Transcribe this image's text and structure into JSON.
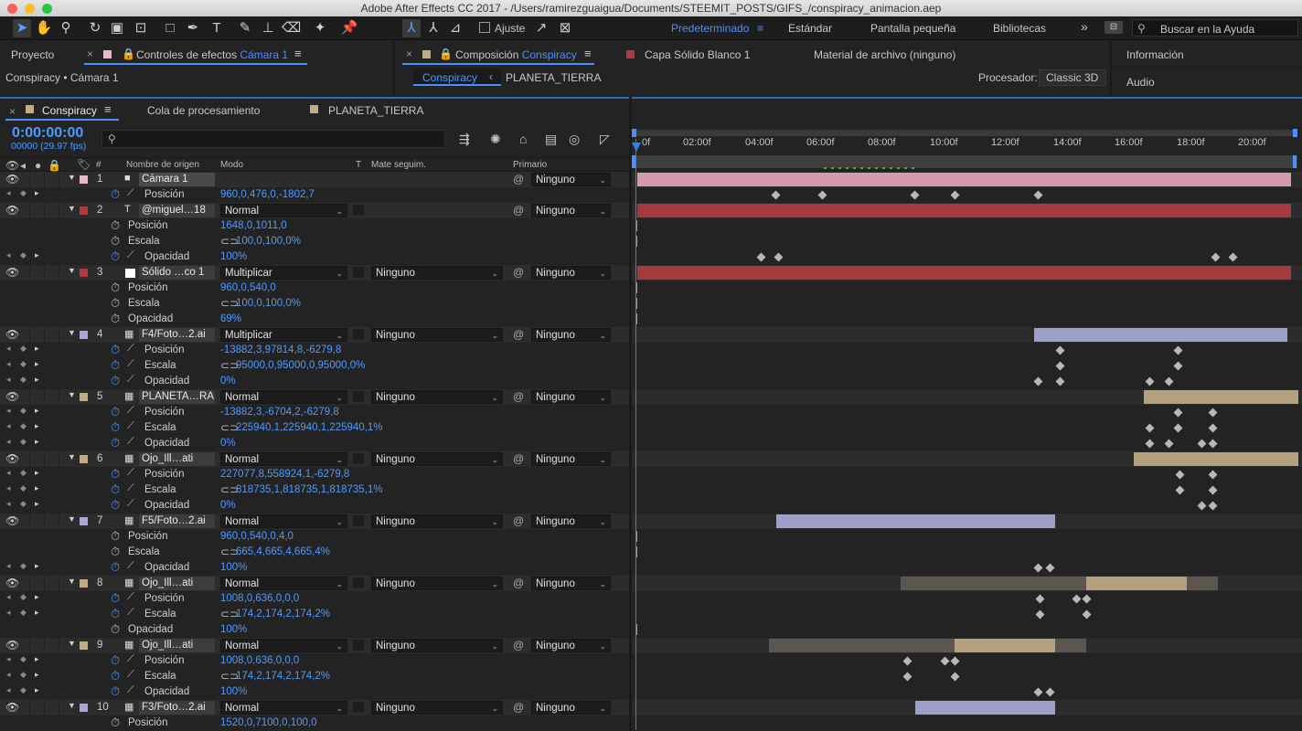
{
  "window_title": "Adobe After Effects CC 2017 - /Users/ramirezguaigua/Documents/STEEMIT_POSTS/GIFS_/conspiracy_animacion.aep",
  "toolbar": {
    "snap_label": "Ajuste",
    "workspaces": [
      "Predeterminado",
      "Estándar",
      "Pantalla pequeña",
      "Bibliotecas"
    ],
    "search_placeholder": "Buscar en la Ayuda"
  },
  "left_panel": {
    "tab_project": "Proyecto",
    "tab_effects_prefix": "Controles de efectos ",
    "tab_effects_target": "Cámara 1",
    "breadcrumb": "Conspiracy • Cámara 1"
  },
  "comp_panel": {
    "tab_prefix": "Composición ",
    "tab_name": "Conspiracy",
    "layer_tab": "Capa Sólido Blanco 1",
    "footage_tab": "Material de archivo (ninguno)",
    "nav_current": "Conspiracy",
    "nav_next": "PLANETA_TIERRA",
    "renderer_label": "Procesador:",
    "renderer_value": "Classic 3D"
  },
  "right_panel": {
    "info": "Información",
    "audio": "Audio"
  },
  "timeline": {
    "tabs": [
      "Conspiracy",
      "Cola de procesamiento",
      "PLANETA_TIERRA"
    ],
    "timecode": "0:00:00:00",
    "frames": "00000 (29.97 fps)",
    "headers": {
      "num": "#",
      "name": "Nombre de origen",
      "mode": "Modo",
      "t": "T",
      "matte": "Mate seguim.",
      "parent": "Primario"
    },
    "ruler": [
      "0f",
      "02:00f",
      "04:00f",
      "06:00f",
      "08:00f",
      "10:00f",
      "12:00f",
      "14:00f",
      "16:00f",
      "18:00f",
      "20:00f"
    ],
    "rows": [
      {
        "type": "layer",
        "num": "1",
        "name": "Cámara 1",
        "color": "#e9b8c8",
        "icon": "camera-icon",
        "mode": "",
        "matte": "",
        "parent": "Ninguno"
      },
      {
        "type": "prop",
        "name": "Posición",
        "value": "960,0,476,0,-1802,7",
        "animated": true
      },
      {
        "type": "layer",
        "num": "2",
        "name": "@miguel…18",
        "color": "#b23a3a",
        "icon": "text-icon",
        "mode": "Normal",
        "matte": "",
        "parent": "Ninguno"
      },
      {
        "type": "prop",
        "name": "Posición",
        "value": "1648,0,1011,0",
        "animated": false
      },
      {
        "type": "prop",
        "name": "Escala",
        "value": "100,0,100,0%",
        "animated": false,
        "link": true
      },
      {
        "type": "prop",
        "name": "Opacidad",
        "value": "100%",
        "animated": true
      },
      {
        "type": "layer",
        "num": "3",
        "name": "Sólido …co 1",
        "color": "#b23a3a",
        "icon": "solid-icon",
        "mode": "Multiplicar",
        "matte": "Ninguno",
        "parent": "Ninguno"
      },
      {
        "type": "prop",
        "name": "Posición",
        "value": "960,0,540,0",
        "animated": false
      },
      {
        "type": "prop",
        "name": "Escala",
        "value": "100,0,100,0%",
        "animated": false,
        "link": true
      },
      {
        "type": "prop",
        "name": "Opacidad",
        "value": "69%",
        "animated": false
      },
      {
        "type": "layer",
        "num": "4",
        "name": "F4/Foto…2.ai",
        "color": "#a9a9d8",
        "icon": "comp-icon",
        "mode": "Multiplicar",
        "matte": "Ninguno",
        "parent": "Ninguno"
      },
      {
        "type": "prop",
        "name": "Posición",
        "value": "-13882,3,97814,8,-6279,8",
        "animated": true
      },
      {
        "type": "prop",
        "name": "Escala",
        "value": "95000,0,95000,0,95000,0%",
        "animated": true,
        "link": true
      },
      {
        "type": "prop",
        "name": "Opacidad",
        "value": "0%",
        "animated": true
      },
      {
        "type": "layer",
        "num": "5",
        "name": "PLANETA…RA",
        "color": "#c2ac85",
        "icon": "footage-icon",
        "mode": "Normal",
        "matte": "Ninguno",
        "parent": "Ninguno"
      },
      {
        "type": "prop",
        "name": "Posición",
        "value": "-13882,3,-6704,2,-6279,8",
        "animated": true
      },
      {
        "type": "prop",
        "name": "Escala",
        "value": "225940,1,225940,1,225940,1%",
        "animated": true,
        "link": true
      },
      {
        "type": "prop",
        "name": "Opacidad",
        "value": "0%",
        "animated": true
      },
      {
        "type": "layer",
        "num": "6",
        "name": "Ojo_Ill…ati",
        "color": "#c2ac85",
        "icon": "footage-icon",
        "mode": "Normal",
        "matte": "Ninguno",
        "parent": "Ninguno"
      },
      {
        "type": "prop",
        "name": "Posición",
        "value": "227077,8,558924,1,-6279,8",
        "animated": true
      },
      {
        "type": "prop",
        "name": "Escala",
        "value": "818735,1,818735,1,818735,1%",
        "animated": true,
        "link": true
      },
      {
        "type": "prop",
        "name": "Opacidad",
        "value": "0%",
        "animated": true
      },
      {
        "type": "layer",
        "num": "7",
        "name": "F5/Foto…2.ai",
        "color": "#a9a9d8",
        "icon": "comp-icon",
        "mode": "Normal",
        "matte": "Ninguno",
        "parent": "Ninguno"
      },
      {
        "type": "prop",
        "name": "Posición",
        "value": "960,0,540,0,4,0",
        "animated": false
      },
      {
        "type": "prop",
        "name": "Escala",
        "value": "665,4,665,4,665,4%",
        "animated": false,
        "link": true
      },
      {
        "type": "prop",
        "name": "Opacidad",
        "value": "100%",
        "animated": true
      },
      {
        "type": "layer",
        "num": "8",
        "name": "Ojo_Ill…ati",
        "color": "#c2ac85",
        "icon": "footage-icon",
        "mode": "Normal",
        "matte": "Ninguno",
        "parent": "Ninguno"
      },
      {
        "type": "prop",
        "name": "Posición",
        "value": "1008,0,636,0,0,0",
        "animated": true
      },
      {
        "type": "prop",
        "name": "Escala",
        "value": "174,2,174,2,174,2%",
        "animated": true,
        "link": true
      },
      {
        "type": "prop",
        "name": "Opacidad",
        "value": "100%",
        "animated": false
      },
      {
        "type": "layer",
        "num": "9",
        "name": "Ojo_Ill…ati",
        "color": "#c2ac85",
        "icon": "footage-icon",
        "mode": "Normal",
        "matte": "Ninguno",
        "parent": "Ninguno"
      },
      {
        "type": "prop",
        "name": "Posición",
        "value": "1008,0,636,0,0,0",
        "animated": true
      },
      {
        "type": "prop",
        "name": "Escala",
        "value": "174,2,174,2,174,2%",
        "animated": true,
        "link": true
      },
      {
        "type": "prop",
        "name": "Opacidad",
        "value": "100%",
        "animated": true
      },
      {
        "type": "layer",
        "num": "10",
        "name": "F3/Foto…2.ai",
        "color": "#a9a9d8",
        "icon": "comp-icon",
        "mode": "Normal",
        "matte": "Ninguno",
        "parent": "Ninguno"
      },
      {
        "type": "prop",
        "name": "Posición",
        "value": "1520,0,7100,0,100,0",
        "animated": false
      }
    ]
  }
}
